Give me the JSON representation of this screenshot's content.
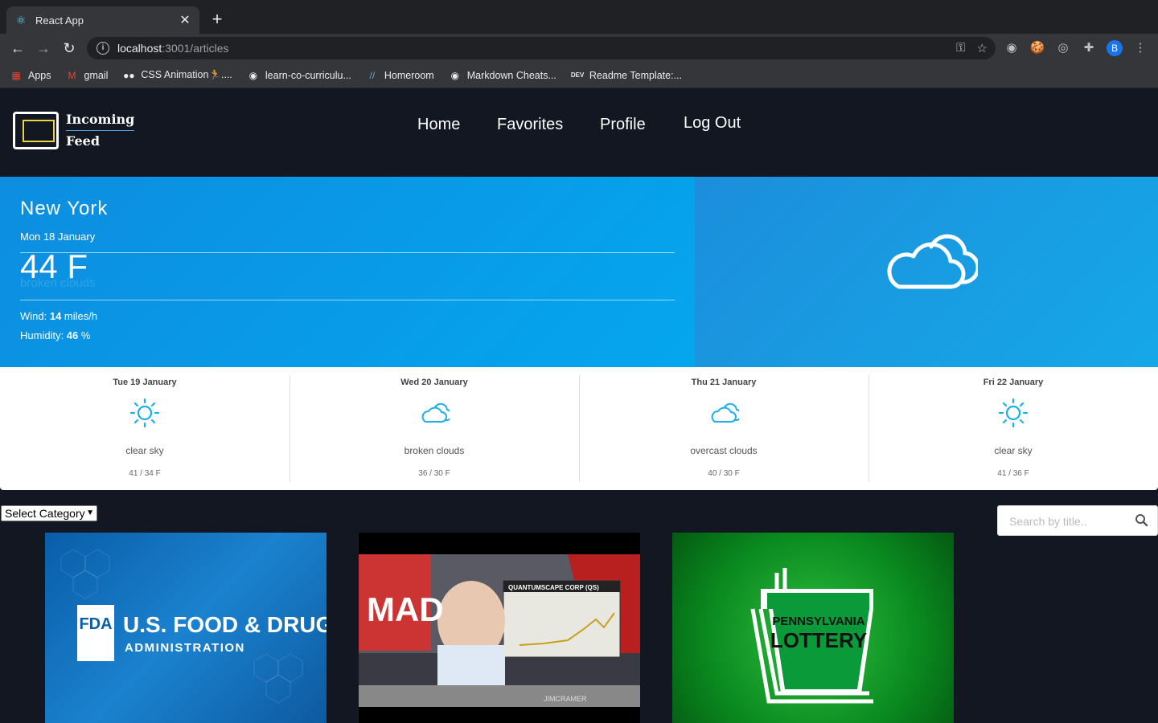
{
  "browser": {
    "tab_title": "React App",
    "url_host": "localhost",
    "url_path": ":3001/articles",
    "profile_initial": "B",
    "bookmarks": [
      {
        "label": "Apps",
        "icon": "apps-grid-icon"
      },
      {
        "label": "gmail",
        "icon": "gmail-icon"
      },
      {
        "label": "CSS Animation🏃....",
        "icon": "medium-icon"
      },
      {
        "label": "learn-co-curriculu...",
        "icon": "github-icon"
      },
      {
        "label": "Homeroom",
        "icon": "homeroom-icon"
      },
      {
        "label": "Markdown Cheats...",
        "icon": "github-icon"
      },
      {
        "label": "Readme Template:...",
        "icon": "dev-icon"
      }
    ]
  },
  "header": {
    "logo_line1": "Incoming",
    "logo_line2": "Feed",
    "nav": [
      "Home",
      "Favorites",
      "Profile",
      "Log Out"
    ]
  },
  "weather": {
    "city": "New York",
    "date": "Mon 18 January",
    "temp": "44 F",
    "description": "broken clouds",
    "wind_label": "Wind: ",
    "wind_value": "14",
    "wind_unit": " miles/h",
    "humidity_label": "Humidity: ",
    "humidity_value": "46",
    "humidity_unit": " %",
    "icon": "cloud-icon"
  },
  "forecast": [
    {
      "date": "Tue 19 January",
      "condition": "clear sky",
      "temps": "41 / 34 F",
      "icon": "sun-icon"
    },
    {
      "date": "Wed 20 January",
      "condition": "broken clouds",
      "temps": "36 / 30 F",
      "icon": "cloud-icon"
    },
    {
      "date": "Thu 21 January",
      "condition": "overcast clouds",
      "temps": "40 / 30 F",
      "icon": "cloud-icon"
    },
    {
      "date": "Fri 22 January",
      "condition": "clear sky",
      "temps": "41 / 36 F",
      "icon": "sun-icon"
    }
  ],
  "controls": {
    "category_selected": "Select Category",
    "search_placeholder": "Search by title.."
  },
  "articles": [
    {
      "image_text_1": "FDA",
      "image_text_2": "U.S. FOOD & DRUG",
      "image_text_3": "ADMINISTRATION"
    },
    {
      "image_text_1": "QUANTUMSCAPE CORP (QS)",
      "image_text_2": "MAD",
      "image_text_3": "JIMCRAMER"
    },
    {
      "image_text_1": "PENNSYLVANIA",
      "image_text_2": "LOTTERY"
    }
  ],
  "colors": {
    "app_bg": "#131722",
    "weather_blue": "#0d8de0",
    "forecast_icon": "#1bb0ea"
  }
}
